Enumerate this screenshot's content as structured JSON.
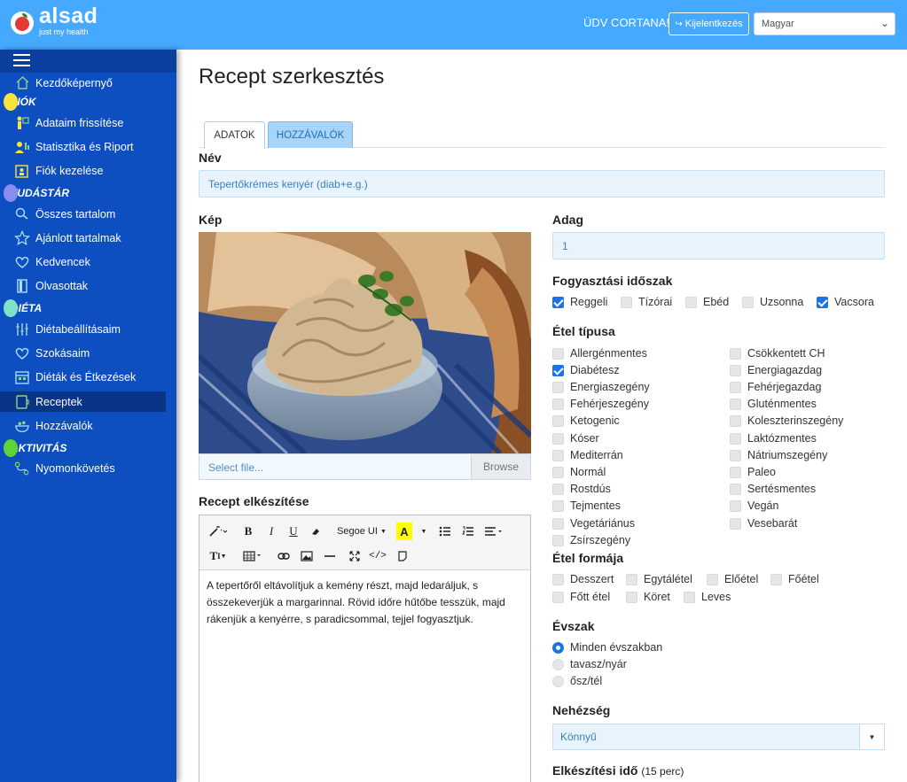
{
  "header": {
    "logo_name": "alsad",
    "logo_tagline": "just my health",
    "greeting": "ÜDV CORTANA!",
    "logout_label": "Kijelentkezés",
    "language": "Magyar"
  },
  "sidebar": {
    "items": {
      "home": {
        "label": "Kezdőképernyő",
        "icon": "house-icon"
      },
      "account_section": "FIÓK",
      "profile": {
        "label": "Adataim frissítése",
        "icon": "person-update-icon"
      },
      "stats": {
        "label": "Statisztika és Riport",
        "icon": "stats-user-icon"
      },
      "manage": {
        "label": "Fiók kezelése",
        "icon": "folder-person-icon"
      },
      "knowledge_section": "TUDÁSTÁR",
      "all_content": {
        "label": "Összes tartalom",
        "icon": "search-icon"
      },
      "recommended": {
        "label": "Ajánlott tartalmak",
        "icon": "star-icon"
      },
      "favorites": {
        "label": "Kedvencek",
        "icon": "heart-icon"
      },
      "read": {
        "label": "Olvasottak",
        "icon": "book-icon"
      },
      "diet_section": "DIÉTA",
      "diet_settings": {
        "label": "Diétabeállításaim",
        "icon": "sliders-icon"
      },
      "habits": {
        "label": "Szokásaim",
        "icon": "heart-icon"
      },
      "diets_meals": {
        "label": "Diéták és Étkezések",
        "icon": "calendar-icon"
      },
      "recipes": {
        "label": "Receptek",
        "icon": "recipe-icon"
      },
      "ingredients": {
        "label": "Hozzávalók",
        "icon": "bowl-icon"
      },
      "activity_section": "AKTIVITÁS",
      "tracking": {
        "label": "Nyomonkövetés",
        "icon": "route-icon"
      }
    }
  },
  "main": {
    "title": "Recept szerkesztés",
    "tabs": {
      "data": "ADATOK",
      "ingredients": "HOZZÁVALÓK"
    },
    "name_label": "Név",
    "name_value": "Tepertőkrémes kenyér (diab+e.g.)",
    "image_label": "Kép",
    "file_placeholder": "Select file...",
    "browse_label": "Browse",
    "prep_label": "Recept elkészítése",
    "editor": {
      "font": "Segoe UI",
      "text": "A tepertőről eltávolítjuk a kemény részt, majd ledaráljuk, s összekeverjük a margarinnal. Rövid időre hűtőbe tesszük, majd rákenjük a kenyérre, s paradicsommal, tejjel fogyasztjuk."
    },
    "portion_label": "Adag",
    "portion_value": "1",
    "period_label": "Fogyasztási időszak",
    "periods": {
      "breakfast": {
        "label": "Reggeli",
        "checked": true
      },
      "brunch": {
        "label": "Tízórai",
        "checked": false
      },
      "lunch": {
        "label": "Ebéd",
        "checked": false
      },
      "snack": {
        "label": "Uzsonna",
        "checked": false
      },
      "dinner": {
        "label": "Vacsora",
        "checked": true
      }
    },
    "type_label": "Étel típusa",
    "types_left": [
      "Allergénmentes",
      "Diabétesz",
      "Energiaszegény",
      "Fehérjeszegény",
      "Ketogenic",
      "Kóser",
      "Mediterrán",
      "Normál",
      "Rostdús",
      "Tejmentes",
      "Vegetáriánus",
      "Zsírszegény"
    ],
    "types_left_checked": [
      false,
      true,
      false,
      false,
      false,
      false,
      false,
      false,
      false,
      false,
      false,
      false
    ],
    "types_right": [
      "Csökkentett CH",
      "Energiagazdag",
      "Fehérjegazdag",
      "Gluténmentes",
      "Koleszterinszegény",
      "Laktózmentes",
      "Nátriumszegény",
      "Paleo",
      "Sertésmentes",
      "Vegán",
      "Vesebarát"
    ],
    "form_label": "Étel formája",
    "forms_row1": [
      "Desszert",
      "Egytálétel",
      "Előétel",
      "Főétel"
    ],
    "forms_row2": [
      "Főtt étel",
      "Köret",
      "Leves"
    ],
    "season_label": "Évszak",
    "seasons": [
      {
        "label": "Minden évszakban",
        "checked": true
      },
      {
        "label": "tavasz/nyár",
        "checked": false
      },
      {
        "label": "ősz/tél",
        "checked": false
      }
    ],
    "difficulty_label": "Nehézség",
    "difficulty_value": "Könnyű",
    "time_label": "Elkészítési idő",
    "time_value": "(15 perc)"
  }
}
